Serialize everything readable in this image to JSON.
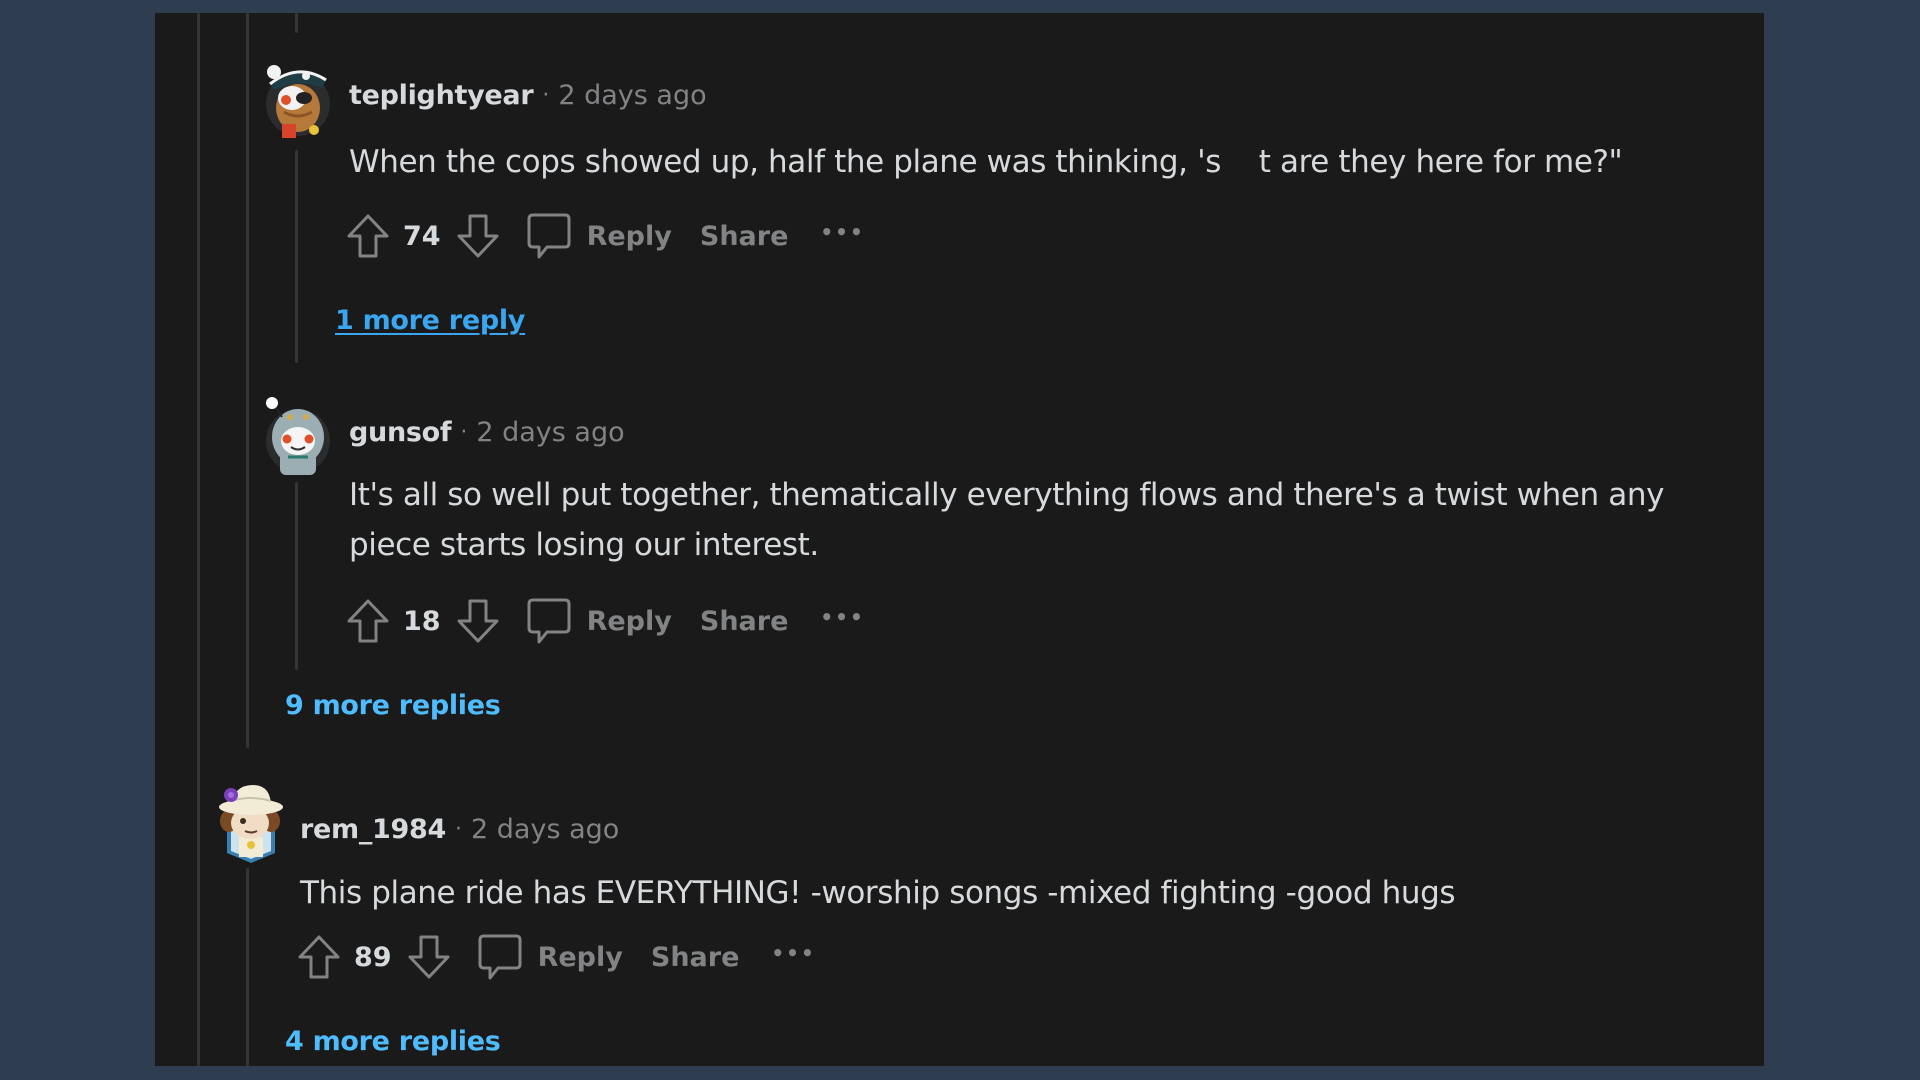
{
  "colors": {
    "page_background": "#2e3e50",
    "panel_background": "#1a1a1b",
    "text_primary": "#d7dadc",
    "text_muted": "#818384",
    "link": "#4fbcff",
    "thread_line": "#343536"
  },
  "separator": "·",
  "comments": [
    {
      "username": "teplightyear",
      "timestamp": "2 days ago",
      "avatar": "pirate-snoo-avatar",
      "body": [
        "When the cops showed up, half the plane was thinking, 's    t are they here for me?\""
      ],
      "score": "74",
      "actions": {
        "reply": "Reply",
        "share": "Share",
        "more": "•••"
      },
      "more_replies": "1 more reply"
    },
    {
      "username": "gunsof",
      "timestamp": "2 days ago",
      "avatar": "hooded-snoo-avatar",
      "body": [
        "It's all so well put together, thematically everything flows and there's a twist when any",
        "piece starts losing our interest."
      ],
      "score": "18",
      "actions": {
        "reply": "Reply",
        "share": "Share",
        "more": "•••"
      },
      "more_replies": "9 more replies"
    },
    {
      "username": "rem_1984",
      "timestamp": "2 days ago",
      "avatar": "hat-character-avatar",
      "body": [
        "This plane ride has EVERYTHING! -worship songs -mixed fighting -good hugs"
      ],
      "score": "89",
      "actions": {
        "reply": "Reply",
        "share": "Share",
        "more": "•••"
      },
      "more_replies": "4 more replies"
    }
  ]
}
